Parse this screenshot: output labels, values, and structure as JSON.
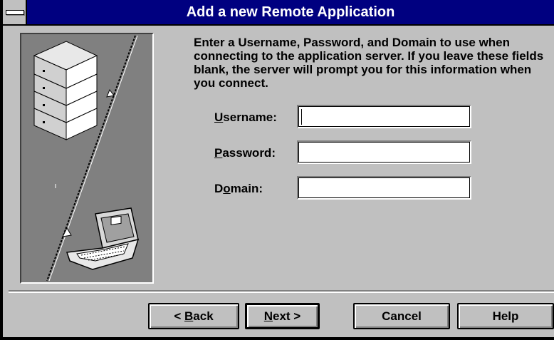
{
  "window": {
    "title": "Add a new Remote Application"
  },
  "instructions": "Enter a Username, Password, and Domain to use when connecting to the application server.  If you leave these fields blank, the server will prompt you for this information when you connect.",
  "fields": {
    "username": {
      "label_mnemonic": "U",
      "label_rest": "sername:",
      "value": ""
    },
    "password": {
      "label_mnemonic": "P",
      "label_rest": "assword:",
      "value": ""
    },
    "domain": {
      "label_pre": "D",
      "label_mnemonic": "o",
      "label_rest": "main:",
      "value": ""
    }
  },
  "buttons": {
    "back": {
      "prefix": "< ",
      "mnemonic": "B",
      "rest": "ack"
    },
    "next": {
      "mnemonic": "N",
      "rest": "ext >"
    },
    "cancel": {
      "label": "Cancel"
    },
    "help": {
      "label": "Help"
    }
  },
  "icons": {
    "system_menu": "system-menu-icon",
    "server": "server-stack-icon",
    "laptop": "laptop-computer-icon"
  },
  "colors": {
    "titlebar": "#000080",
    "face": "#c0c0c0",
    "illustration_bg": "#808080"
  }
}
